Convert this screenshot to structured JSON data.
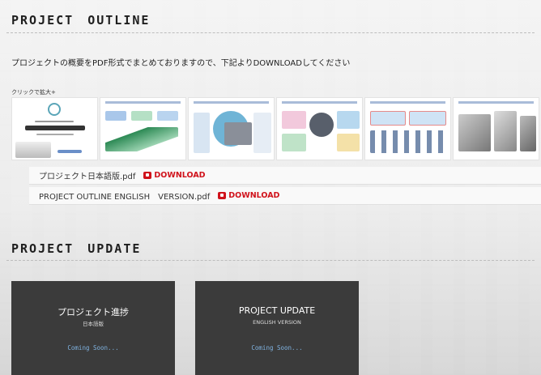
{
  "outline": {
    "title": "PROJECT　OUTLINE",
    "intro": "プロジェクトの概要をPDF形式でまとめておりますので、下記よりDOWNLOADしてください",
    "zoom_hint": "クリックで拡大+",
    "thumbnail_count": 6,
    "downloads": [
      {
        "filename": "プロジェクト日本語版.pdf",
        "link_label": "DOWNLOAD"
      },
      {
        "filename": "PROJECT OUTLINE ENGLISH　VERSION.pdf",
        "link_label": "DOWNLOAD"
      }
    ]
  },
  "update": {
    "title": "PROJECT　UPDATE",
    "cards": [
      {
        "title": "プロジェクト進捗",
        "subtitle": "日本語版",
        "status": "Coming Soon..."
      },
      {
        "title": "PROJECT UPDATE",
        "subtitle": "ENGLISH VERSION",
        "status": "Coming Soon..."
      }
    ]
  },
  "colors": {
    "download_red": "#d0121b",
    "card_bg": "#3b3b3b",
    "coming_soon_blue": "#7fb2e0"
  }
}
